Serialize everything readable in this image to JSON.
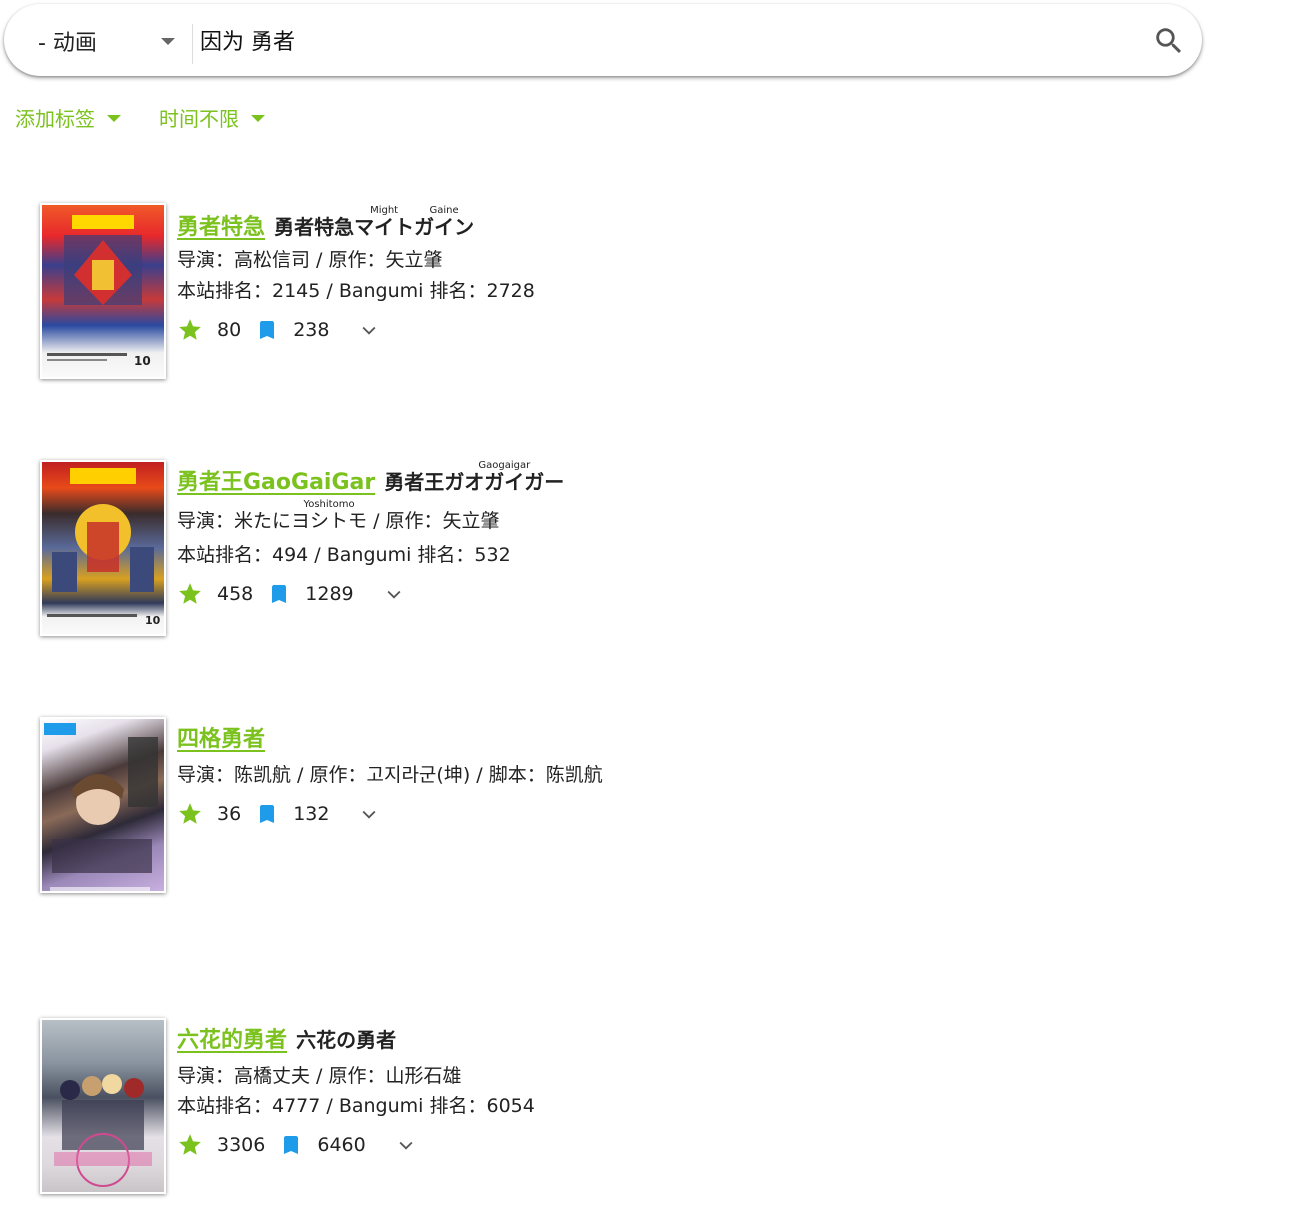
{
  "search": {
    "category": "- 动画",
    "query": "因为 勇者"
  },
  "filters": {
    "tag_label": "添加标签",
    "time_label": "时间不限"
  },
  "colors": {
    "accent": "#7bc21f",
    "collect": "#1e9be9"
  },
  "results": [
    {
      "title_cn": "勇者特急",
      "title_jp_base": "勇者特急マイトガイン",
      "title_jp_ruby": [
        {
          "base": "勇者特急",
          "rt": ""
        },
        {
          "base": "マイト",
          "rt": "Might"
        },
        {
          "base": "ガイン",
          "rt": "Gaine"
        }
      ],
      "credits": "导演：高松信司 / 原作：矢立肇",
      "rank": "本站排名：2145 / Bangumi 排名：2728",
      "rating": "80",
      "collect": "238"
    },
    {
      "title_cn": "勇者王GaoGaiGar",
      "title_jp_ruby": [
        {
          "base": "勇者王",
          "rt": ""
        },
        {
          "base": "ガオガイガー",
          "rt": "Gaogaigar"
        }
      ],
      "credits_parts": {
        "director_prefix": "导演：米たに",
        "director_ruby_base": "ヨシトモ",
        "director_ruby_rt": "Yoshitomo",
        "rest": " / 原作：矢立肇"
      },
      "rank": "本站排名：494 / Bangumi 排名：532",
      "rating": "458",
      "collect": "1289"
    },
    {
      "title_cn": "四格勇者",
      "credits": "导演：陈凯航 / 原作：고지라군(坤) / 脚本：陈凯航",
      "rating": "36",
      "collect": "132"
    },
    {
      "title_cn": "六花的勇者",
      "title_jp": "六花の勇者",
      "credits": "导演：高橋丈夫 / 原作：山形石雄",
      "rank": "本站排名：4777 / Bangumi 排名：6054",
      "rating": "3306",
      "collect": "6460"
    }
  ]
}
